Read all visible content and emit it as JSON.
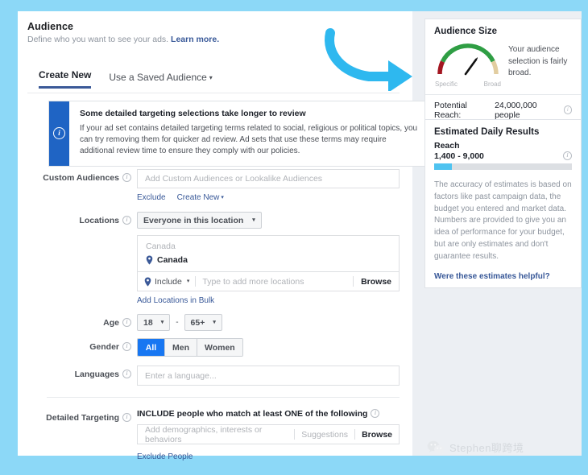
{
  "header": {
    "title": "Audience",
    "subtitle": "Define who you want to see your ads.",
    "learn_more": "Learn more."
  },
  "tabs": [
    {
      "label": "Create New",
      "active": true
    },
    {
      "label": "Use a Saved Audience",
      "active": false,
      "caret": "▾"
    }
  ],
  "notice": {
    "icon": "info-icon",
    "heading": "Some detailed targeting selections take longer to review",
    "body": "If your ad set contains detailed targeting terms related to social, religious or political topics, you can try removing them for quicker ad review. Ad sets that use these terms may require additional review time to ensure they comply with our policies."
  },
  "form": {
    "custom_audiences": {
      "label": "Custom Audiences",
      "placeholder": "Add Custom Audiences or Lookalike Audiences",
      "value": "",
      "links": [
        {
          "label": "Exclude"
        },
        {
          "label": "Create New",
          "caret": "▾"
        }
      ]
    },
    "locations": {
      "label": "Locations",
      "scope_select": "Everyone in this location",
      "caret": "▾",
      "group_header": "Canada",
      "selected": [
        {
          "name": "Canada",
          "icon": "location-pin-icon"
        }
      ],
      "include_label": "Include",
      "input_placeholder": "Type to add more locations",
      "input_value": "",
      "browse_label": "Browse",
      "bulk_link": "Add Locations in Bulk"
    },
    "age": {
      "label": "Age",
      "min": "18",
      "max": "65+",
      "separator": "-",
      "caret": "▾"
    },
    "gender": {
      "label": "Gender",
      "options": [
        "All",
        "Men",
        "Women"
      ],
      "selected": "All"
    },
    "languages": {
      "label": "Languages",
      "placeholder": "Enter a language...",
      "value": ""
    },
    "detailed_targeting": {
      "label": "Detailed Targeting",
      "include_text": "INCLUDE people who match at least ONE of the following",
      "placeholder": "Add demographics, interests or behaviors",
      "value": "",
      "suggestions_label": "Suggestions",
      "browse_label": "Browse",
      "exclude_link": "Exclude People"
    }
  },
  "sidebar": {
    "audience_size": {
      "title": "Audience Size",
      "gauge": {
        "left_label": "Specific",
        "right_label": "Broad",
        "needle_position": 0.62,
        "colors": {
          "low": "#a31621",
          "mid": "#2f9e44",
          "high": "#e2cda0"
        }
      },
      "summary": "Your audience selection is fairly broad.",
      "potential_reach_label": "Potential Reach:",
      "potential_reach_value": "24,000,000 people"
    },
    "estimated_daily_results": {
      "title": "Estimated Daily Results",
      "metric_label": "Reach",
      "metric_range": "1,400 - 9,000",
      "meter_fill_percent": 13,
      "meter_fill_color": "#4fc3f0",
      "disclaimer": "The accuracy of estimates is based on factors like past campaign data, the budget you entered and market data. Numbers are provided to give you an idea of performance for your budget, but are only estimates and don't guarantee results.",
      "feedback_link": "Were these estimates helpful?"
    }
  },
  "annotation": {
    "arrow": "curved-arrow-right",
    "arrow_color": "#2eb8ef"
  },
  "watermark": {
    "icon": "wechat-icon",
    "text": "Stephen聊跨境"
  }
}
